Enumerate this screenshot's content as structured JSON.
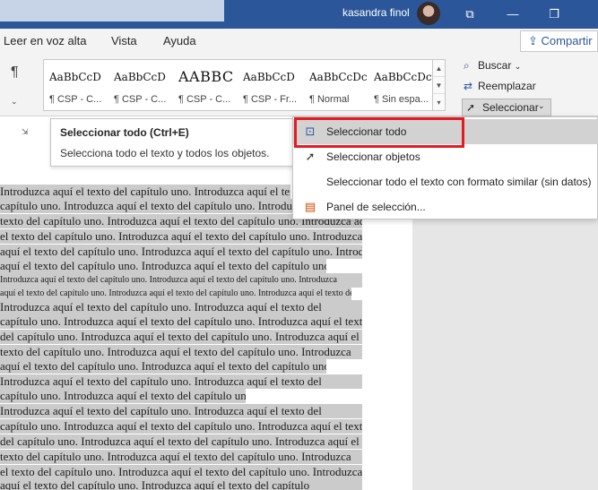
{
  "titlebar": {
    "user_name": "kasandra finol",
    "min_icon": "⧉",
    "max_icon": "❐"
  },
  "tabs": [
    {
      "label": "Leer en voz alta"
    },
    {
      "label": "Vista"
    },
    {
      "label": "Ayuda"
    }
  ],
  "share": {
    "label": "Compartir",
    "icon": "⇪"
  },
  "ribbon": {
    "paragraph_mark": "¶",
    "styles": [
      {
        "sample": "AaBbCcD",
        "name": "¶ CSP - C..."
      },
      {
        "sample": "AaBbCcD",
        "name": "¶ CSP - C..."
      },
      {
        "sample": "AABBC",
        "name": "¶ CSP - C..."
      },
      {
        "sample": "AaBbCcD",
        "name": "¶ CSP - Fr..."
      },
      {
        "sample": "AaBbCcDc",
        "name": "¶ Normal"
      },
      {
        "sample": "AaBbCcDc",
        "name": "¶ Sin espa..."
      }
    ],
    "buscar": "Buscar",
    "reemplazar": "Reemplazar",
    "seleccionar": "Seleccionar"
  },
  "tooltip": {
    "title": "Seleccionar todo (Ctrl+E)",
    "description": "Selecciona todo el texto y todos los objetos."
  },
  "menu": {
    "items": [
      {
        "label": "Seleccionar todo",
        "icon": "select-all-icon"
      },
      {
        "label": "Seleccionar objetos",
        "icon": "pointer-icon"
      },
      {
        "label": "Seleccionar todo el texto con formato similar (sin datos)",
        "icon": ""
      },
      {
        "label": "Panel de selección...",
        "icon": "selection-pane-icon"
      }
    ]
  },
  "document": {
    "lines": [
      "Introduzca aquí el texto del capítulo uno. Introduzca aquí el texto del",
      "capítulo uno. Introduzca aquí el texto del capítulo uno. Introduzca aquí el",
      "texto del capítulo uno. Introduzca aquí el texto del capítulo uno. Introduzca aquí",
      "el texto del capítulo uno. Introduzca aquí el texto del capítulo uno. Introduzca",
      "aquí el texto del capítulo uno. Introduzca aquí el texto del capítulo uno. Introduzca",
      "aquí el texto del capítulo uno. Introduzca aquí el texto del capítulo uno.",
      "Introduzca aquí el texto del capítulo uno. Introduzca aquí el texto del capítulo uno. Introduzca",
      "aquí el texto del capítulo uno. Introduzca aquí el texto del capítulo uno. Introduzca aquí el texto del capítulo uno.",
      "Introduzca aquí el texto del capítulo uno. Introduzca aquí el texto del",
      "capítulo uno. Introduzca aquí el texto del capítulo uno. Introduzca aquí el texto",
      "del capítulo uno. Introduzca aquí el texto del capítulo uno. Introduzca aquí el",
      "texto del capítulo uno. Introduzca aquí el texto del capítulo uno. Introduzca",
      "aquí el texto del capítulo uno. Introduzca aquí el texto del capítulo uno.",
      "Introduzca aquí el texto del capítulo uno. Introduzca aquí el texto del",
      "capítulo uno. Introduzca aquí el texto del capítulo uno.",
      "Introduzca aquí el texto del capítulo uno. Introduzca aquí el texto del",
      "capítulo uno. Introduzca aquí el texto del capítulo uno. Introduzca aquí el texto",
      "del capítulo uno. Introduzca aquí el texto del capítulo uno. Introduzca aquí el",
      "texto del capítulo uno. Introduzca aquí el texto del capítulo uno. Introduzca",
      "el texto del capítulo uno. Introduzca aquí el texto del capítulo uno. Introduzca",
      "aquí el texto del capítulo uno. Introduzca aquí el texto del capítulo"
    ]
  }
}
